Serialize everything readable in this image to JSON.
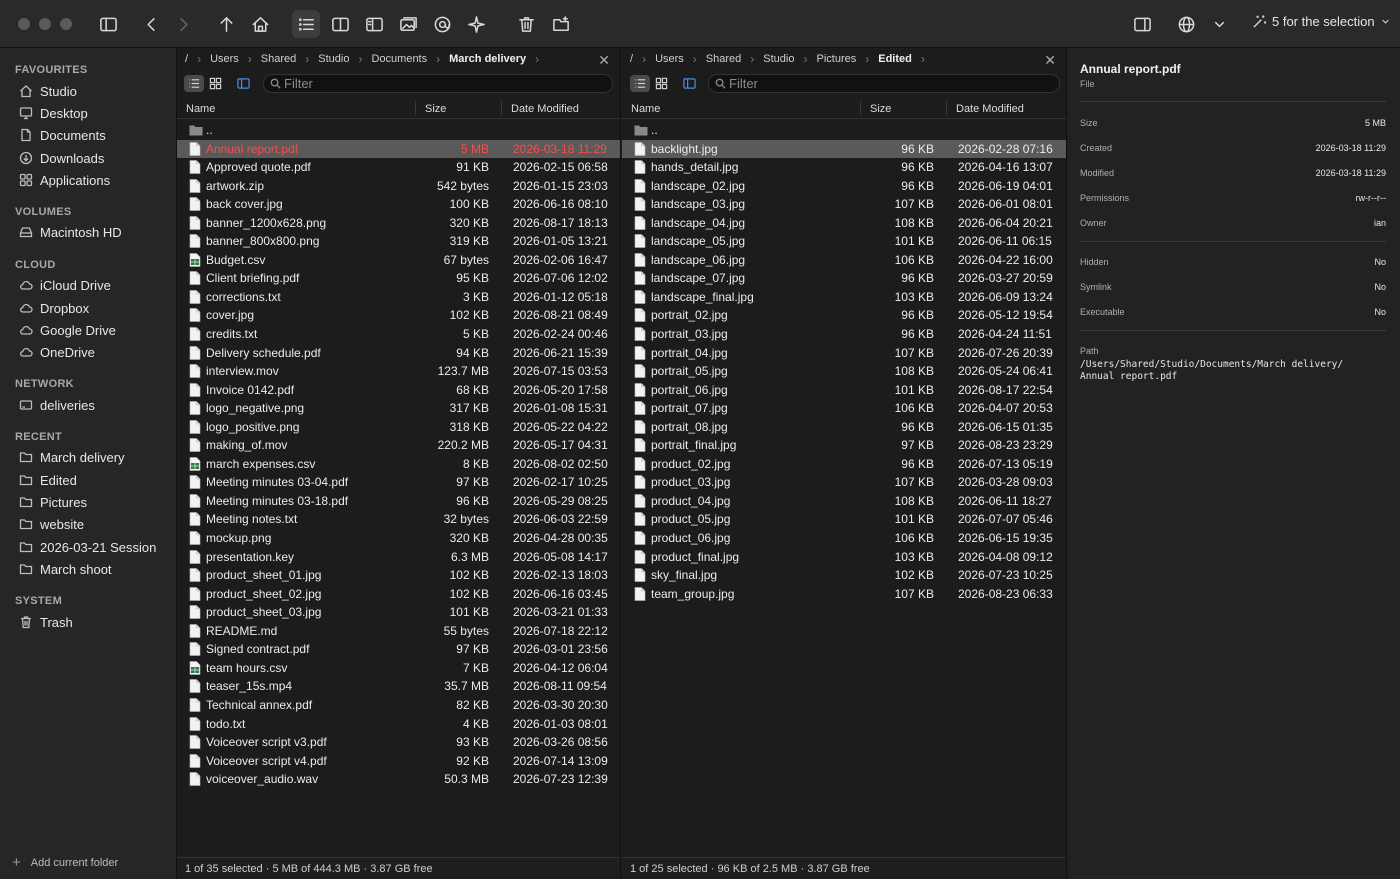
{
  "toolbar": {
    "selection_label": "5 for the selection"
  },
  "sidebar": {
    "sections": [
      {
        "title": "FAVOURITES",
        "items": [
          {
            "label": "Studio",
            "icon": "home-icon"
          },
          {
            "label": "Desktop",
            "icon": "desktop-icon"
          },
          {
            "label": "Documents",
            "icon": "document-icon"
          },
          {
            "label": "Downloads",
            "icon": "download-icon"
          },
          {
            "label": "Applications",
            "icon": "applications-icon"
          }
        ]
      },
      {
        "title": "VOLUMES",
        "items": [
          {
            "label": "Macintosh HD",
            "icon": "drive-icon"
          }
        ]
      },
      {
        "title": "CLOUD",
        "items": [
          {
            "label": "iCloud Drive",
            "icon": "cloud-icon"
          },
          {
            "label": "Dropbox",
            "icon": "cloud-icon"
          },
          {
            "label": "Google Drive",
            "icon": "cloud-icon"
          },
          {
            "label": "OneDrive",
            "icon": "cloud-icon"
          }
        ]
      },
      {
        "title": "NETWORK",
        "items": [
          {
            "label": "deliveries",
            "icon": "network-drive-icon"
          }
        ]
      },
      {
        "title": "RECENT",
        "items": [
          {
            "label": "March delivery",
            "icon": "folder-icon"
          },
          {
            "label": "Edited",
            "icon": "folder-icon"
          },
          {
            "label": "Pictures",
            "icon": "folder-icon"
          },
          {
            "label": "website",
            "icon": "folder-icon"
          },
          {
            "label": "2026-03-21 Session",
            "icon": "folder-icon"
          },
          {
            "label": "March shoot",
            "icon": "folder-icon"
          }
        ]
      },
      {
        "title": "SYSTEM",
        "items": [
          {
            "label": "Trash",
            "icon": "trash-icon"
          }
        ]
      }
    ],
    "add_folder_label": "Add current folder"
  },
  "left_pane": {
    "breadcrumb": [
      "/",
      "Users",
      "Shared",
      "Studio",
      "Documents",
      "March delivery"
    ],
    "filter_placeholder": "Filter",
    "columns": {
      "name": "Name",
      "size": "Size",
      "date": "Date Modified"
    },
    "parent_label": "..",
    "files": [
      {
        "name": "Annual report.pdf",
        "size": "5 MB",
        "date": "2026-03-18 11:29",
        "type": "doc",
        "selected": true
      },
      {
        "name": "Approved quote.pdf",
        "size": "91 KB",
        "date": "2026-02-15 06:58",
        "type": "doc"
      },
      {
        "name": "artwork.zip",
        "size": "542 bytes",
        "date": "2026-01-15 23:03",
        "type": "doc"
      },
      {
        "name": "back cover.jpg",
        "size": "100 KB",
        "date": "2026-06-16 08:10",
        "type": "doc"
      },
      {
        "name": "banner_1200x628.png",
        "size": "320 KB",
        "date": "2026-08-17 18:13",
        "type": "doc"
      },
      {
        "name": "banner_800x800.png",
        "size": "319 KB",
        "date": "2026-01-05 13:21",
        "type": "doc"
      },
      {
        "name": "Budget.csv",
        "size": "67 bytes",
        "date": "2026-02-06 16:47",
        "type": "sheet"
      },
      {
        "name": "Client briefing.pdf",
        "size": "95 KB",
        "date": "2026-07-06 12:02",
        "type": "doc"
      },
      {
        "name": "corrections.txt",
        "size": "3 KB",
        "date": "2026-01-12 05:18",
        "type": "doc"
      },
      {
        "name": "cover.jpg",
        "size": "102 KB",
        "date": "2026-08-21 08:49",
        "type": "doc"
      },
      {
        "name": "credits.txt",
        "size": "5 KB",
        "date": "2026-02-24 00:46",
        "type": "doc"
      },
      {
        "name": "Delivery schedule.pdf",
        "size": "94 KB",
        "date": "2026-06-21 15:39",
        "type": "doc"
      },
      {
        "name": "interview.mov",
        "size": "123.7 MB",
        "date": "2026-07-15 03:53",
        "type": "doc"
      },
      {
        "name": "Invoice 0142.pdf",
        "size": "68 KB",
        "date": "2026-05-20 17:58",
        "type": "doc"
      },
      {
        "name": "logo_negative.png",
        "size": "317 KB",
        "date": "2026-01-08 15:31",
        "type": "doc"
      },
      {
        "name": "logo_positive.png",
        "size": "318 KB",
        "date": "2026-05-22 04:22",
        "type": "doc"
      },
      {
        "name": "making_of.mov",
        "size": "220.2 MB",
        "date": "2026-05-17 04:31",
        "type": "doc"
      },
      {
        "name": "march expenses.csv",
        "size": "8 KB",
        "date": "2026-08-02 02:50",
        "type": "sheet"
      },
      {
        "name": "Meeting minutes 03-04.pdf",
        "size": "97 KB",
        "date": "2026-02-17 10:25",
        "type": "doc"
      },
      {
        "name": "Meeting minutes 03-18.pdf",
        "size": "96 KB",
        "date": "2026-05-29 08:25",
        "type": "doc"
      },
      {
        "name": "Meeting notes.txt",
        "size": "32 bytes",
        "date": "2026-06-03 22:59",
        "type": "doc"
      },
      {
        "name": "mockup.png",
        "size": "320 KB",
        "date": "2026-04-28 00:35",
        "type": "doc"
      },
      {
        "name": "presentation.key",
        "size": "6.3 MB",
        "date": "2026-05-08 14:17",
        "type": "doc"
      },
      {
        "name": "product_sheet_01.jpg",
        "size": "102 KB",
        "date": "2026-02-13 18:03",
        "type": "doc"
      },
      {
        "name": "product_sheet_02.jpg",
        "size": "102 KB",
        "date": "2026-06-16 03:45",
        "type": "doc"
      },
      {
        "name": "product_sheet_03.jpg",
        "size": "101 KB",
        "date": "2026-03-21 01:33",
        "type": "doc"
      },
      {
        "name": "README.md",
        "size": "55 bytes",
        "date": "2026-07-18 22:12",
        "type": "doc"
      },
      {
        "name": "Signed contract.pdf",
        "size": "97 KB",
        "date": "2026-03-01 23:56",
        "type": "doc"
      },
      {
        "name": "team hours.csv",
        "size": "7 KB",
        "date": "2026-04-12 06:04",
        "type": "sheet"
      },
      {
        "name": "teaser_15s.mp4",
        "size": "35.7 MB",
        "date": "2026-08-11 09:54",
        "type": "doc"
      },
      {
        "name": "Technical annex.pdf",
        "size": "82 KB",
        "date": "2026-03-30 20:30",
        "type": "doc"
      },
      {
        "name": "todo.txt",
        "size": "4 KB",
        "date": "2026-01-03 08:01",
        "type": "doc"
      },
      {
        "name": "Voiceover script v3.pdf",
        "size": "93 KB",
        "date": "2026-03-26 08:56",
        "type": "doc"
      },
      {
        "name": "Voiceover script v4.pdf",
        "size": "92 KB",
        "date": "2026-07-14 13:09",
        "type": "doc"
      },
      {
        "name": "voiceover_audio.wav",
        "size": "50.3 MB",
        "date": "2026-07-23 12:39",
        "type": "doc"
      }
    ],
    "status": "1 of 35 selected · 5 MB of 444.3 MB · 3.87 GB free"
  },
  "right_pane": {
    "breadcrumb": [
      "/",
      "Users",
      "Shared",
      "Studio",
      "Pictures",
      "Edited"
    ],
    "filter_placeholder": "Filter",
    "columns": {
      "name": "Name",
      "size": "Size",
      "date": "Date Modified"
    },
    "parent_label": "..",
    "files": [
      {
        "name": "backlight.jpg",
        "size": "96 KB",
        "date": "2026-02-28 07:16",
        "type": "doc",
        "selected": true
      },
      {
        "name": "hands_detail.jpg",
        "size": "96 KB",
        "date": "2026-04-16 13:07",
        "type": "doc"
      },
      {
        "name": "landscape_02.jpg",
        "size": "96 KB",
        "date": "2026-06-19 04:01",
        "type": "doc"
      },
      {
        "name": "landscape_03.jpg",
        "size": "107 KB",
        "date": "2026-06-01 08:01",
        "type": "doc"
      },
      {
        "name": "landscape_04.jpg",
        "size": "108 KB",
        "date": "2026-06-04 20:21",
        "type": "doc"
      },
      {
        "name": "landscape_05.jpg",
        "size": "101 KB",
        "date": "2026-06-11 06:15",
        "type": "doc"
      },
      {
        "name": "landscape_06.jpg",
        "size": "106 KB",
        "date": "2026-04-22 16:00",
        "type": "doc"
      },
      {
        "name": "landscape_07.jpg",
        "size": "96 KB",
        "date": "2026-03-27 20:59",
        "type": "doc"
      },
      {
        "name": "landscape_final.jpg",
        "size": "103 KB",
        "date": "2026-06-09 13:24",
        "type": "doc"
      },
      {
        "name": "portrait_02.jpg",
        "size": "96 KB",
        "date": "2026-05-12 19:54",
        "type": "doc"
      },
      {
        "name": "portrait_03.jpg",
        "size": "96 KB",
        "date": "2026-04-24 11:51",
        "type": "doc"
      },
      {
        "name": "portrait_04.jpg",
        "size": "107 KB",
        "date": "2026-07-26 20:39",
        "type": "doc"
      },
      {
        "name": "portrait_05.jpg",
        "size": "108 KB",
        "date": "2026-05-24 06:41",
        "type": "doc"
      },
      {
        "name": "portrait_06.jpg",
        "size": "101 KB",
        "date": "2026-08-17 22:54",
        "type": "doc"
      },
      {
        "name": "portrait_07.jpg",
        "size": "106 KB",
        "date": "2026-04-07 20:53",
        "type": "doc"
      },
      {
        "name": "portrait_08.jpg",
        "size": "96 KB",
        "date": "2026-06-15 01:35",
        "type": "doc"
      },
      {
        "name": "portrait_final.jpg",
        "size": "97 KB",
        "date": "2026-08-23 23:29",
        "type": "doc"
      },
      {
        "name": "product_02.jpg",
        "size": "96 KB",
        "date": "2026-07-13 05:19",
        "type": "doc"
      },
      {
        "name": "product_03.jpg",
        "size": "107 KB",
        "date": "2026-03-28 09:03",
        "type": "doc"
      },
      {
        "name": "product_04.jpg",
        "size": "108 KB",
        "date": "2026-06-11 18:27",
        "type": "doc"
      },
      {
        "name": "product_05.jpg",
        "size": "101 KB",
        "date": "2026-07-07 05:46",
        "type": "doc"
      },
      {
        "name": "product_06.jpg",
        "size": "106 KB",
        "date": "2026-06-15 19:35",
        "type": "doc"
      },
      {
        "name": "product_final.jpg",
        "size": "103 KB",
        "date": "2026-04-08 09:12",
        "type": "doc"
      },
      {
        "name": "sky_final.jpg",
        "size": "102 KB",
        "date": "2026-07-23 10:25",
        "type": "doc"
      },
      {
        "name": "team_group.jpg",
        "size": "107 KB",
        "date": "2026-08-23 06:33",
        "type": "doc"
      }
    ],
    "status": "1 of 25 selected · 96 KB of 2.5 MB · 3.87 GB free"
  },
  "inspector": {
    "title": "Annual report.pdf",
    "kind": "File",
    "size_k": "Size",
    "size_v": "5 MB",
    "created_k": "Created",
    "created_v": "2026-03-18 11:29",
    "modified_k": "Modified",
    "modified_v": "2026-03-18 11:29",
    "permissions_k": "Permissions",
    "permissions_v": "rw-r--r--",
    "owner_k": "Owner",
    "owner_v": "ian",
    "hidden_k": "Hidden",
    "hidden_v": "No",
    "symlink_k": "Symlink",
    "symlink_v": "No",
    "executable_k": "Executable",
    "executable_v": "No",
    "path_k": "Path",
    "path_v": "/Users/Shared/Studio/Documents/March delivery/\nAnnual report.pdf"
  },
  "colors": {
    "selected_row": "#5a5a5a",
    "selected_text_red": "#ff4a4a",
    "accent_blue": "#4a8de8"
  }
}
